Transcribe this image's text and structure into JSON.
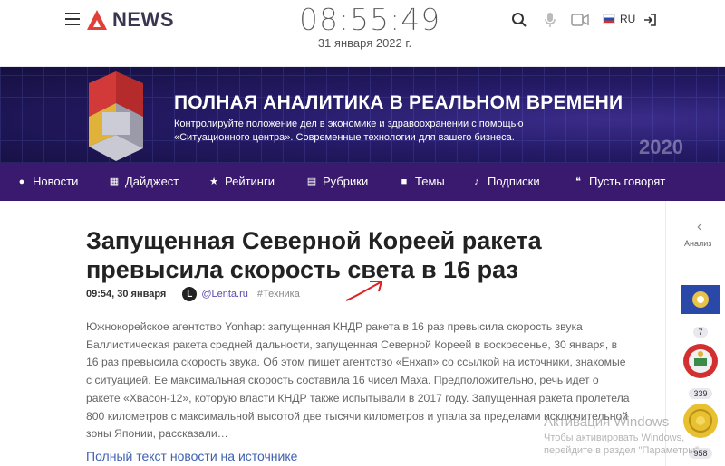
{
  "header": {
    "logo_text": "NEWS",
    "clock_time": "08:55:49",
    "clock_date": "31 января 2022 г.",
    "lang": "RU"
  },
  "banner": {
    "title": "ПОЛНАЯ АНАЛИТИКА В РЕАЛЬНОМ ВРЕМЕНИ",
    "subtitle": "Контролируйте положение дел в экономике и здравоохранении с помощью «Ситуационного центра». Современные технологии для вашего бизнеса.",
    "deco_year": "2020"
  },
  "nav": {
    "items": [
      {
        "label": "Новости",
        "icon": "globe-icon"
      },
      {
        "label": "Дайджест",
        "icon": "digest-icon"
      },
      {
        "label": "Рейтинги",
        "icon": "star-icon"
      },
      {
        "label": "Рубрики",
        "icon": "rubrics-icon"
      },
      {
        "label": "Темы",
        "icon": "topics-icon"
      },
      {
        "label": "Подписки",
        "icon": "bell-icon"
      },
      {
        "label": "Пусть говорят",
        "icon": "quote-icon"
      }
    ]
  },
  "article": {
    "title": "Запущенная Северной Кореей ракета превысила скорость света в 16 раз",
    "time": "09:54, 30 января",
    "source_logo": "L",
    "source": "@Lenta.ru",
    "tag": "#Техника",
    "body": "Южнокорейское агентство Yonhap: запущенная КНДР ракета в 16 раз превысила скорость звука Баллистическая ракета средней дальности, запущенная Северной Кореей в воскресенье, 30 января, в 16 раз превысила скорость звука. Об этом пишет агентство «Ёнхап» со ссылкой на источники, знакомые с ситуацией. Ее максимальная скорость составила 16 чисел Маха. Предположительно, речь идет о ракете «Хвасон-12», которую власти КНДР также испытывали в 2017 году. Запущенная ракета пролетела 800 километров с максимальной высотой две тысячи километров и упала за пределами исключительной зоны Японии, рассказали…",
    "full_link": "Полный текст новости на источнике"
  },
  "sidebar": {
    "label": "Анализ",
    "items": [
      {
        "count": "7"
      },
      {
        "count": "339"
      },
      {
        "count": "958"
      }
    ]
  },
  "watermark": {
    "line1": "Активация Windows",
    "line2": "Чтобы активировать Windows, перейдите в раздел \"Параметры\"."
  },
  "colors": {
    "nav_bg": "#3a1a6e",
    "accent_red": "#e0403a",
    "link_blue": "#4060b0"
  }
}
